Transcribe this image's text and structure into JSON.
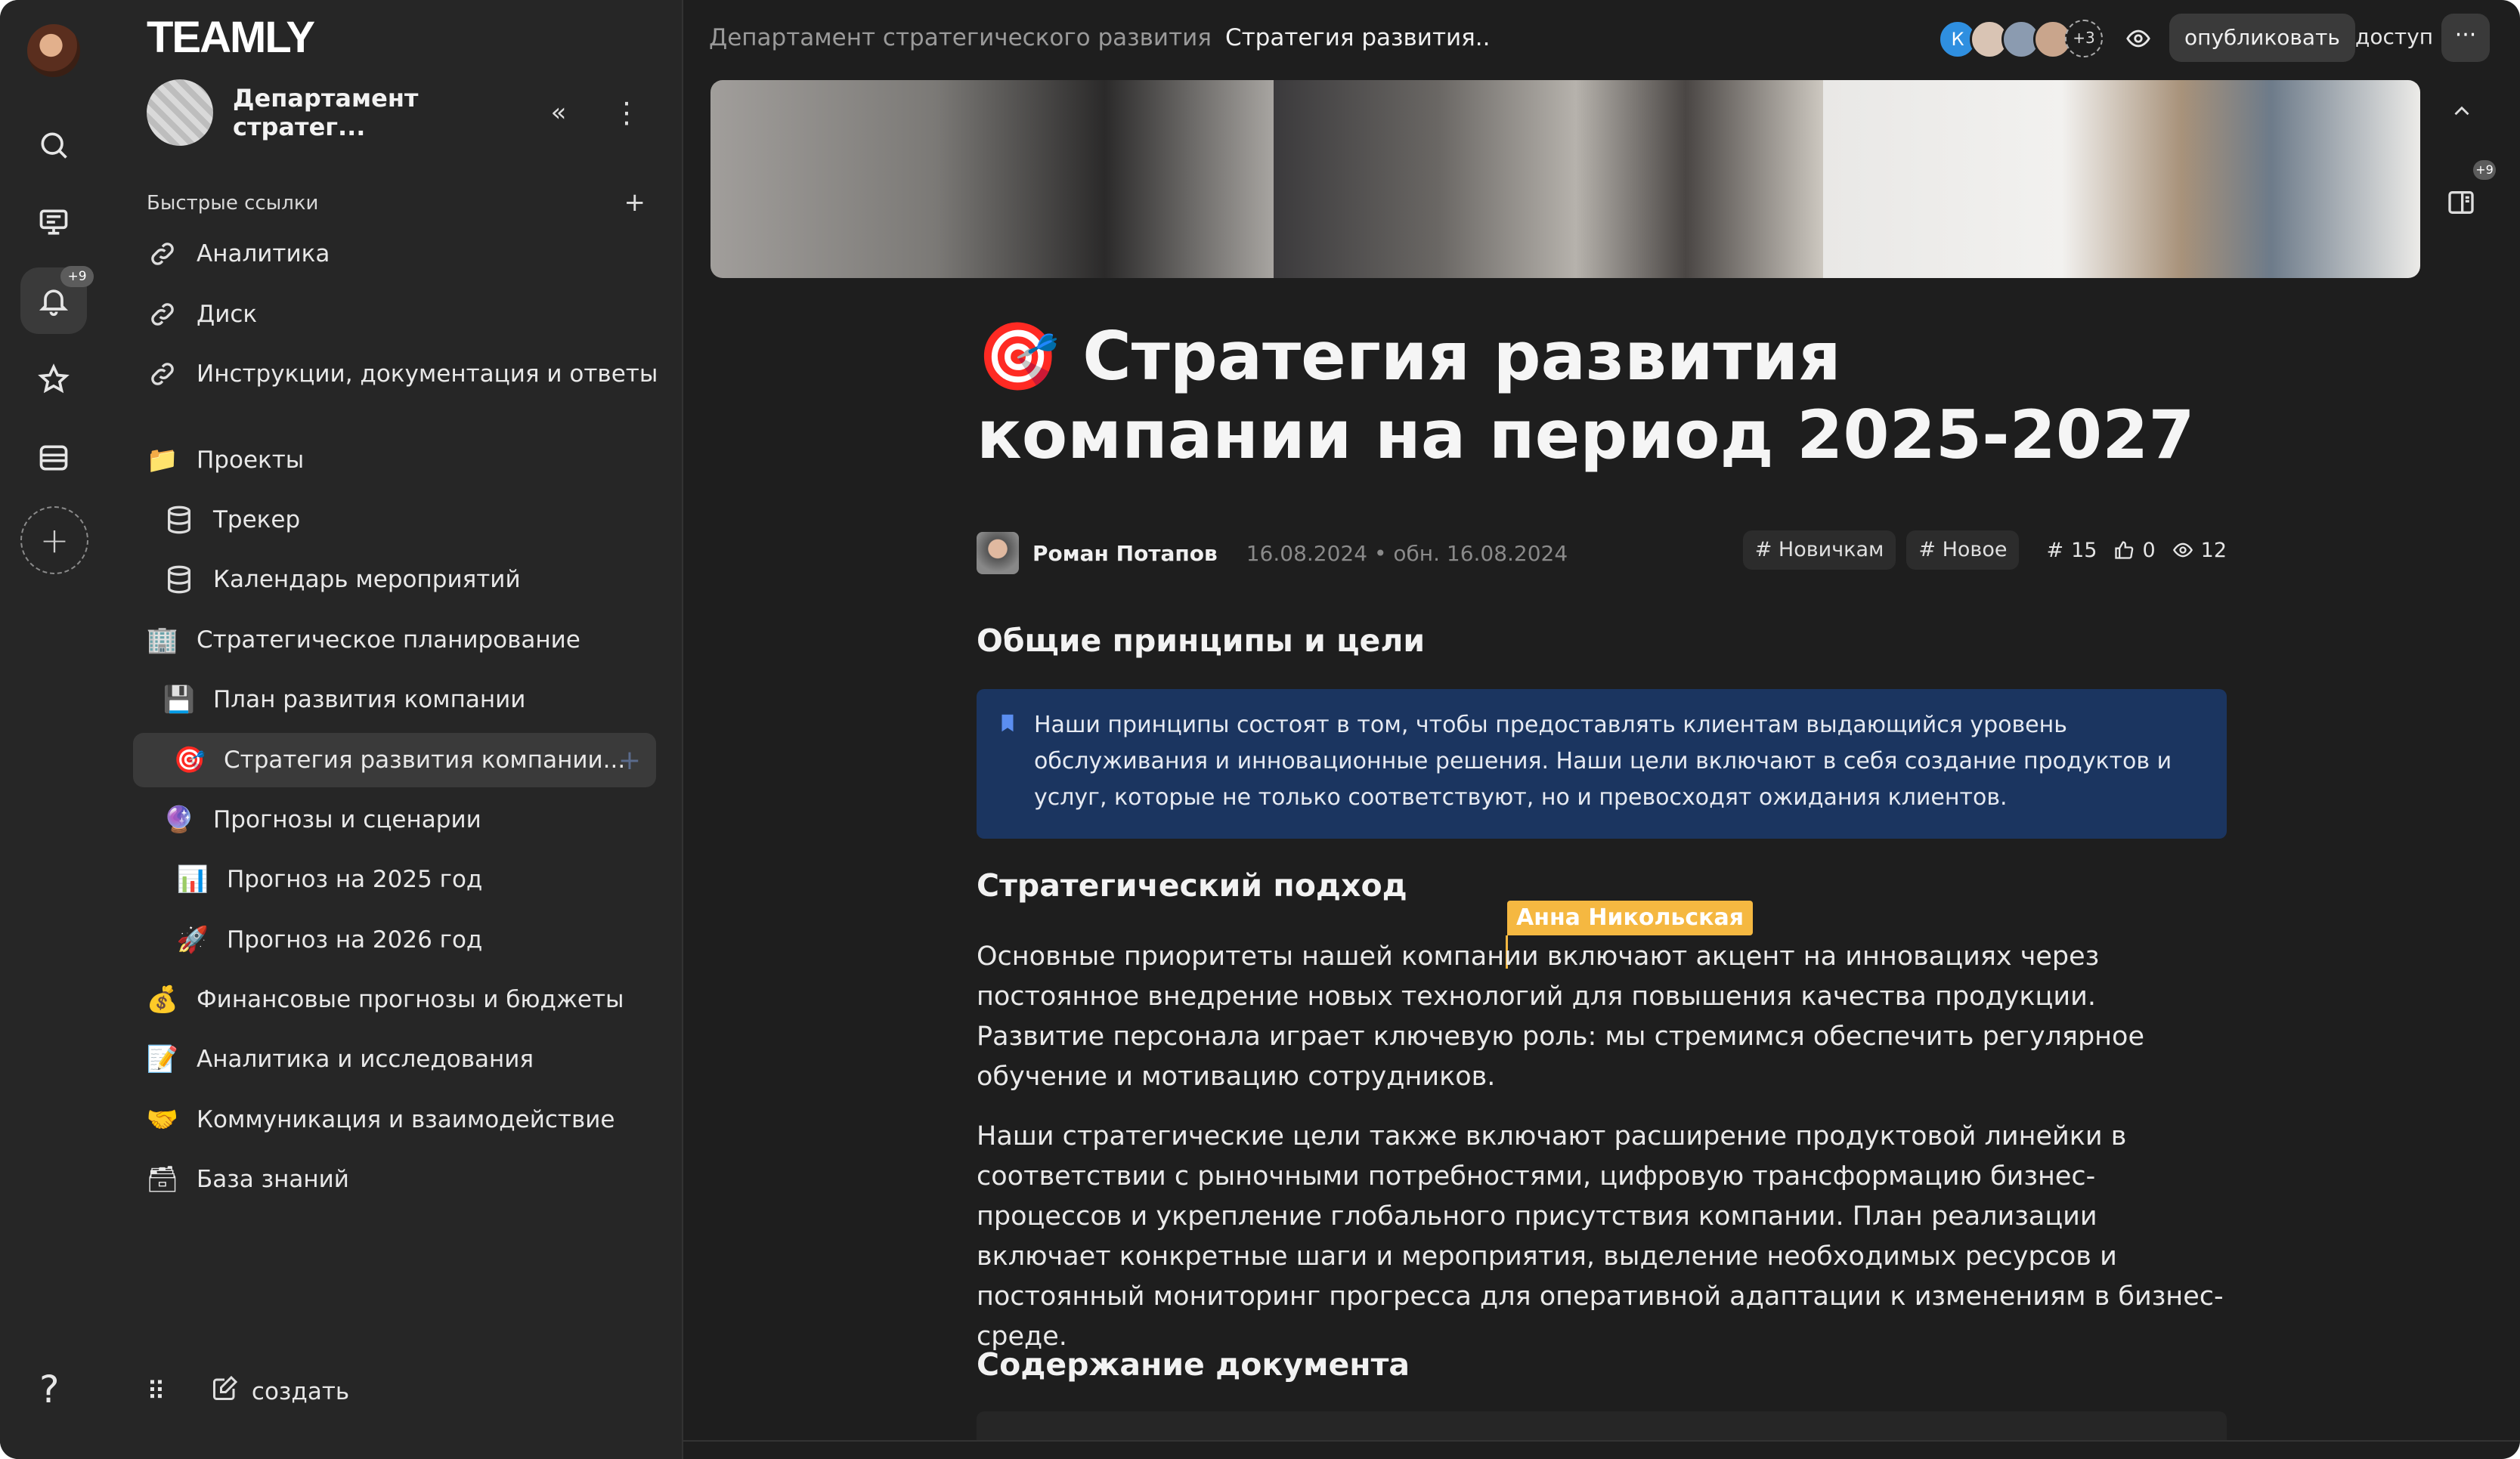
{
  "rail": {
    "notifications_badge": "+9",
    "help_label": "?"
  },
  "sidebar": {
    "logo": "TEAMLY",
    "workspace_name": "Департамент стратег...",
    "quick_links_label": "Быстрые ссылки",
    "quick_links": [
      {
        "label": "Аналитика",
        "icon": "link-icon"
      },
      {
        "label": "Диск",
        "icon": "link-icon"
      },
      {
        "label": "Инструкции, документация и ответы",
        "icon": "link-icon"
      }
    ],
    "tree": [
      {
        "label": "Проекты",
        "icon": "📁"
      },
      {
        "label": "Трекер",
        "icon": "database-icon"
      },
      {
        "label": "Календарь мероприятий",
        "icon": "database-icon"
      },
      {
        "label": "Стратегическое планирование",
        "icon": "🏢"
      },
      {
        "label": "План развития компании",
        "icon": "💾"
      },
      {
        "label": "Стратегия развития компании...",
        "icon": "🎯"
      },
      {
        "label": "Прогнозы и сценарии",
        "icon": "🔮"
      },
      {
        "label": "Прогноз на 2025 год",
        "icon": "📊"
      },
      {
        "label": "Прогноз на 2026 год",
        "icon": "🚀"
      },
      {
        "label": "Финансовые прогнозы и бюджеты",
        "icon": "💰"
      },
      {
        "label": "Аналитика и исследования",
        "icon": "📝"
      },
      {
        "label": "Коммуникация и взаимодействие",
        "icon": "🤝"
      },
      {
        "label": "База знаний",
        "icon": "🗃"
      }
    ],
    "create_label": "создать"
  },
  "topbar": {
    "breadcrumb_parent": "Департамент стратегического развития",
    "breadcrumb_current": "Стратегия развития..",
    "avatar_first_letter": "К",
    "avatar_more": "+3",
    "publish_label": "опубликовать",
    "access_label": "доступ",
    "more_label": "···"
  },
  "right_panel": {
    "badge": "+9"
  },
  "article": {
    "title_emoji": "🎯",
    "title": "Стратегия развития компании на период 2025-2027",
    "author": "Роман Потапов",
    "date": "16.08.2024 • обн. 16.08.2024",
    "tags": [
      "Новичкам",
      "Новое"
    ],
    "stats": {
      "hash": "15",
      "likes": "0",
      "views": "12"
    },
    "section1_heading": "Общие принципы и цели",
    "callout": "Наши принципы состоят в том, чтобы предоставлять клиентам выдающийся уровень обслуживания и инновационные решения. Наши цели включают в себя создание продуктов и услуг, которые не только соответствуют, но и превосходят ожидания клиентов.",
    "section2_heading": "Стратегический подход",
    "collaborator_cursor": "Анна Никольская",
    "para1": "Основные приоритеты нашей компании включают акцент на инновациях через постоянное внедрение новых технологий для повышения качества продукции. Развитие персонала играет ключевую роль: мы стремимся обеспечить регулярное обучение и мотивацию сотрудников.",
    "para2": "Наши стратегические цели также включают расширение продуктовой линейки в соответствии с рыночными потребностями, цифровую трансформацию бизнес-процессов и укрепление глобального присутствия компании. План реализации включает конкретные шаги и мероприятия, выделение необходимых ресурсов и постоянный мониторинг прогресса для оперативной адаптации к изменениям в бизнес-среде.",
    "section3_heading": "Содержание документа"
  },
  "colors": {
    "background": "#1e1e1e",
    "sidebar": "#262626",
    "callout": "#1b3560",
    "cursor": "#f5b841",
    "accent_avatar": "#2f8fe0"
  }
}
